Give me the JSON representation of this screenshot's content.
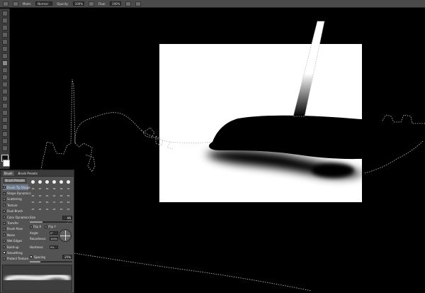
{
  "options_bar": {
    "mode_label": "Mode:",
    "mode_value": "Normal",
    "opacity_label": "Opacity:",
    "opacity_value": "100%",
    "flow_label": "Flow:",
    "flow_value": "100%"
  },
  "toolbar": {
    "tools": [
      "move",
      "marquee",
      "lasso",
      "quick-select",
      "crop",
      "eyedropper",
      "healing",
      "brush",
      "clone-stamp",
      "history-brush",
      "eraser",
      "gradient",
      "blur",
      "dodge",
      "pen",
      "type",
      "path-select",
      "shape",
      "hand",
      "zoom"
    ],
    "active_tool": "brush"
  },
  "brush_panel": {
    "tabs": [
      "Brush",
      "Brush Presets"
    ],
    "presets_button": "Brush Presets",
    "categories": [
      {
        "label": "Brush Tip Shape",
        "checked": false,
        "selected": true
      },
      {
        "label": "Shape Dynamics",
        "checked": false,
        "selected": false
      },
      {
        "label": "Scattering",
        "checked": false,
        "selected": false
      },
      {
        "label": "Texture",
        "checked": false,
        "selected": false
      },
      {
        "label": "Dual Brush",
        "checked": false,
        "selected": false
      },
      {
        "label": "Color Dynamics",
        "checked": false,
        "selected": false
      },
      {
        "label": "Transfer",
        "checked": false,
        "selected": false
      },
      {
        "label": "Brush Pose",
        "checked": false,
        "selected": false
      },
      {
        "label": "Noise",
        "checked": false,
        "selected": false
      },
      {
        "label": "Wet Edges",
        "checked": false,
        "selected": false
      },
      {
        "label": "Build-up",
        "checked": false,
        "selected": false
      },
      {
        "label": "Smoothing",
        "checked": true,
        "selected": false
      },
      {
        "label": "Protect Texture",
        "checked": false,
        "selected": false
      }
    ],
    "tip_sizes": [
      "30",
      "30",
      "30",
      "25",
      "25",
      "25",
      "36",
      "25",
      "36",
      "36",
      "36",
      "32",
      "25",
      "25",
      "25",
      "25",
      "50",
      "25",
      "25",
      "25",
      "50",
      "71",
      "25",
      "50",
      "25",
      "25",
      "25",
      "25",
      "25",
      "25"
    ],
    "size_label": "Size",
    "size_value": "96 px",
    "size_fraction": 0.3,
    "flip_x": "Flip X",
    "flip_y": "Flip Y",
    "angle_label": "Angle:",
    "angle_value": "0°",
    "roundness_label": "Roundness:",
    "roundness_value": "100%",
    "hardness_label": "Hardness",
    "hardness_value": "0%",
    "spacing_label": "Spacing",
    "spacing_value": "25%",
    "spacing_fraction": 0.25
  }
}
